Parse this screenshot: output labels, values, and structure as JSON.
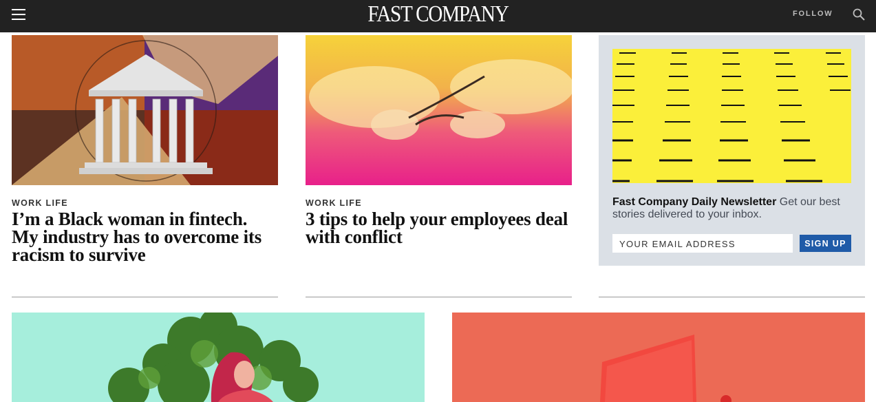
{
  "header": {
    "logo_text": "FAST COMPANY",
    "follow_label": "FOLLOW",
    "icons": {
      "menu": "hamburger-menu-icon",
      "search": "search-icon"
    }
  },
  "articles": [
    {
      "kicker": "WORK LIFE",
      "headline": "I’m a Black woman in fintech. My industry has to overcome its racism to survive",
      "image": "greek-temple-illustration"
    },
    {
      "kicker": "WORK LIFE",
      "headline": "3 tips to help your employees deal with conflict",
      "image": "fighting-gazelles-photo"
    }
  ],
  "newsletter": {
    "title": "Fast Company Daily Newsletter",
    "body": " Get our best stories delivered to your inbox.",
    "email_placeholder": "YOUR EMAIL ADDRESS",
    "signup_label": "SIGN UP",
    "image": "yellow-lines-pattern"
  },
  "bottom_cards": [
    {
      "image": "woman-and-tree-illustration"
    },
    {
      "image": "red-laptop-illustration"
    }
  ],
  "colors": {
    "topbar": "#222222",
    "signup_button": "#1f5ba8",
    "newsletter_bg": "#dbe0e6"
  }
}
